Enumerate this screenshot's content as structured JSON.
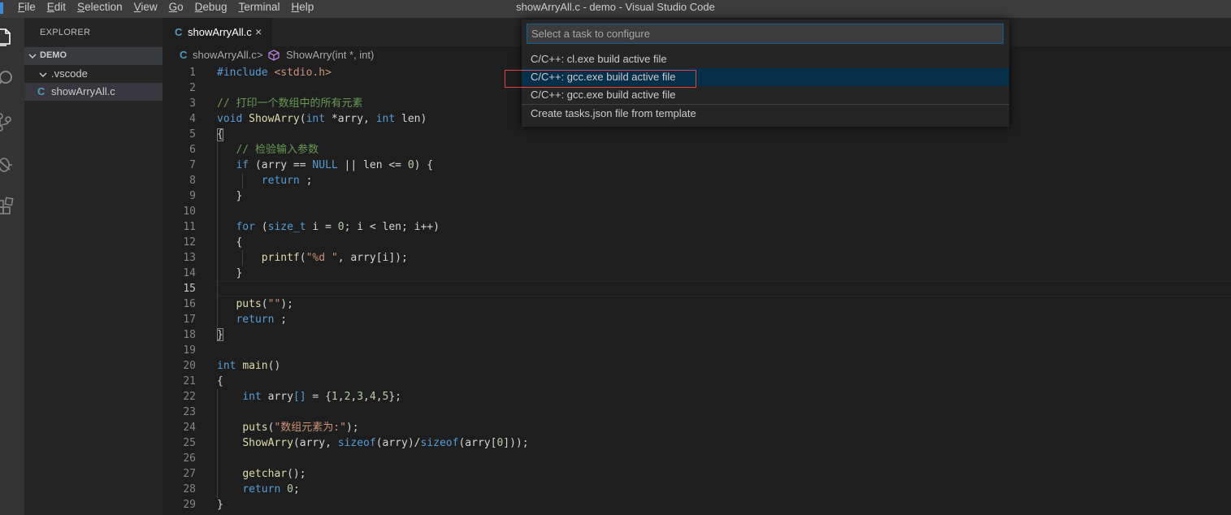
{
  "titlebar": {
    "menu": [
      {
        "first": "F",
        "rest": "ile"
      },
      {
        "first": "E",
        "rest": "dit"
      },
      {
        "first": "S",
        "rest": "election"
      },
      {
        "first": "V",
        "rest": "iew"
      },
      {
        "first": "G",
        "rest": "o"
      },
      {
        "first": "D",
        "rest": "ebug"
      },
      {
        "first": "T",
        "rest": "erminal"
      },
      {
        "first": "H",
        "rest": "elp"
      }
    ],
    "window_title": "showArryAll.c - demo - Visual Studio Code"
  },
  "activitybar": {
    "icons": [
      "files-icon",
      "search-icon",
      "source-control-icon",
      "debug-icon",
      "extensions-icon"
    ]
  },
  "sidebar": {
    "title": "EXPLORER",
    "folder": "DEMO",
    "items": [
      {
        "label": ".vscode",
        "icon": "chevron-down-icon"
      },
      {
        "label": "showArryAll.c",
        "icon": "c",
        "selected": true
      }
    ]
  },
  "tab": {
    "icon": "C",
    "label": "showArryAll.c",
    "close": "×"
  },
  "breadcrumb": {
    "icon": "C",
    "file": "showArryAll.c",
    "separator": ">",
    "symbol": "ShowArry(int *, int)"
  },
  "colors": {
    "keyword": "#569cd6",
    "string": "#ce9178",
    "number": "#b5cea8",
    "comment": "#6a9955",
    "function": "#dcdcaa",
    "text": "#d4d4d4",
    "quickpick_focus": "#062f4a",
    "highlight_box": "#e04343"
  },
  "code": {
    "lines": [
      [
        [
          "kw",
          "#include"
        ],
        [
          "id",
          " "
        ],
        [
          "str",
          "<stdio.h>"
        ]
      ],
      [],
      [
        [
          "cmt",
          "// 打印一个数组中的所有元素"
        ]
      ],
      [
        [
          "kw",
          "void"
        ],
        [
          "id",
          " "
        ],
        [
          "fn",
          "ShowArry"
        ],
        [
          "id",
          "("
        ],
        [
          "kw",
          "int"
        ],
        [
          "id",
          " *arry, "
        ],
        [
          "kw",
          "int"
        ],
        [
          "id",
          " len)"
        ]
      ],
      [
        [
          "id",
          "{"
        ]
      ],
      [
        [
          "id",
          "   "
        ],
        [
          "cmt",
          "// 检验输入参数"
        ]
      ],
      [
        [
          "id",
          "   "
        ],
        [
          "kw",
          "if"
        ],
        [
          "id",
          " (arry == "
        ],
        [
          "kw",
          "NULL"
        ],
        [
          "id",
          " || len <= "
        ],
        [
          "num",
          "0"
        ],
        [
          "id",
          ") {"
        ]
      ],
      [
        [
          "id",
          "       "
        ],
        [
          "kw",
          "return"
        ],
        [
          "id",
          " ;"
        ]
      ],
      [
        [
          "id",
          "   }"
        ]
      ],
      [],
      [
        [
          "id",
          "   "
        ],
        [
          "kw",
          "for"
        ],
        [
          "id",
          " ("
        ],
        [
          "kw",
          "size_t"
        ],
        [
          "id",
          " i = "
        ],
        [
          "num",
          "0"
        ],
        [
          "id",
          "; i < len; i++)"
        ]
      ],
      [
        [
          "id",
          "   {"
        ]
      ],
      [
        [
          "id",
          "       "
        ],
        [
          "fn",
          "printf"
        ],
        [
          "id",
          "("
        ],
        [
          "str",
          "\"%d \""
        ],
        [
          "id",
          ", arry[i]);"
        ]
      ],
      [
        [
          "id",
          "   }"
        ]
      ],
      [],
      [
        [
          "id",
          "   "
        ],
        [
          "fn",
          "puts"
        ],
        [
          "id",
          "("
        ],
        [
          "str",
          "\"\""
        ],
        [
          "id",
          ");"
        ]
      ],
      [
        [
          "id",
          "   "
        ],
        [
          "kw",
          "return"
        ],
        [
          "id",
          " ;"
        ]
      ],
      [
        [
          "id",
          "}"
        ]
      ],
      [],
      [
        [
          "kw",
          "int"
        ],
        [
          "id",
          " "
        ],
        [
          "fn",
          "main"
        ],
        [
          "id",
          "()"
        ]
      ],
      [
        [
          "id",
          "{"
        ]
      ],
      [
        [
          "id",
          "    "
        ],
        [
          "kw",
          "int"
        ],
        [
          "id",
          " arry"
        ],
        [
          "kw",
          "[]"
        ],
        [
          "id",
          " = {"
        ],
        [
          "num",
          "1"
        ],
        [
          "id",
          ","
        ],
        [
          "num",
          "2"
        ],
        [
          "id",
          ","
        ],
        [
          "num",
          "3"
        ],
        [
          "id",
          ","
        ],
        [
          "num",
          "4"
        ],
        [
          "id",
          ","
        ],
        [
          "num",
          "5"
        ],
        [
          "id",
          "};"
        ]
      ],
      [],
      [
        [
          "id",
          "    "
        ],
        [
          "fn",
          "puts"
        ],
        [
          "id",
          "("
        ],
        [
          "str",
          "\"数组元素为:\""
        ],
        [
          "id",
          ");"
        ]
      ],
      [
        [
          "id",
          "    "
        ],
        [
          "fn",
          "ShowArry"
        ],
        [
          "id",
          "(arry, "
        ],
        [
          "kw",
          "sizeof"
        ],
        [
          "id",
          "(arry)/"
        ],
        [
          "kw",
          "sizeof"
        ],
        [
          "id",
          "(arry["
        ],
        [
          "num",
          "0"
        ],
        [
          "id",
          "]));"
        ]
      ],
      [],
      [
        [
          "id",
          "    "
        ],
        [
          "fn",
          "getchar"
        ],
        [
          "id",
          "();"
        ]
      ],
      [
        [
          "id",
          "    "
        ],
        [
          "kw",
          "return"
        ],
        [
          "id",
          " "
        ],
        [
          "num",
          "0"
        ],
        [
          "id",
          ";"
        ]
      ],
      [
        [
          "id",
          "}"
        ]
      ]
    ],
    "line_numbers": [
      "1",
      "2",
      "3",
      "4",
      "5",
      "6",
      "7",
      "8",
      "9",
      "10",
      "11",
      "12",
      "13",
      "14",
      "15",
      "16",
      "17",
      "18",
      "19",
      "20",
      "21",
      "22",
      "23",
      "24",
      "25",
      "26",
      "27",
      "28",
      "29"
    ],
    "active_line": 15
  },
  "quickpick": {
    "placeholder": "Select a task to configure",
    "items": [
      {
        "label": "C/C++: cl.exe build active file",
        "focused": false
      },
      {
        "label": "C/C++: gcc.exe build active file",
        "focused": true
      },
      {
        "label": "C/C++: gcc.exe build active file",
        "focused": false
      },
      {
        "label": "Create tasks.json file from template",
        "focused": false
      }
    ]
  }
}
